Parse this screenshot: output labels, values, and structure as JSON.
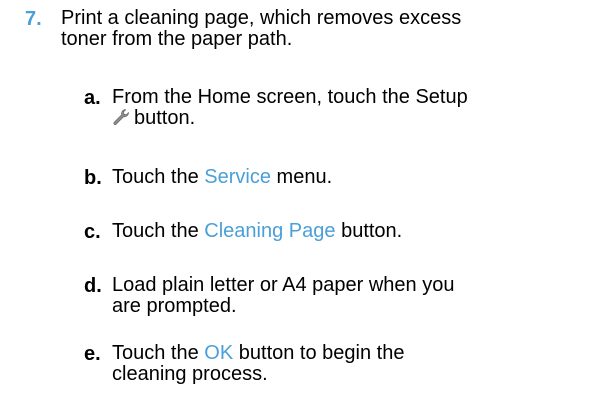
{
  "step": {
    "number": "7.",
    "text_line1": "Print a cleaning page, which removes excess",
    "text_line2": "toner from the paper path."
  },
  "substeps": [
    {
      "letter": "a.",
      "line1": "From the Home screen, touch the Setup",
      "line2_after_icon": "button.",
      "icon": "wrench-icon"
    },
    {
      "letter": "b.",
      "before": "Touch the ",
      "highlight": "Service",
      "after": " menu."
    },
    {
      "letter": "c.",
      "before": "Touch the ",
      "highlight": "Cleaning Page",
      "after": " button."
    },
    {
      "letter": "d.",
      "line1": "Load plain letter or A4 paper when you",
      "line2": "are prompted."
    },
    {
      "letter": "e.",
      "before": "Touch the ",
      "highlight": "OK",
      "after": " button to begin the",
      "line2": "cleaning process."
    }
  ],
  "colors": {
    "accent": "#4a9fd8",
    "text": "#000000"
  }
}
